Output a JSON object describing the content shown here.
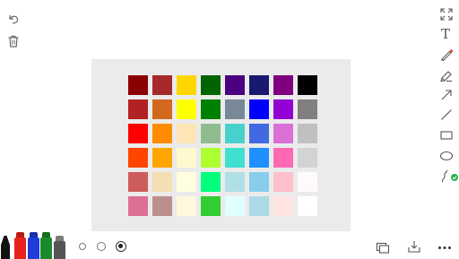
{
  "left_tools": {
    "undo_icon": "undo-icon",
    "delete_icon": "trash-icon"
  },
  "right_toolbar": {
    "items": [
      {
        "name": "fullscreen-icon"
      },
      {
        "name": "text-tool-icon",
        "glyph": "T"
      },
      {
        "name": "pen-tool-icon",
        "accent": "#e0403a"
      },
      {
        "name": "highlighter-tool-icon"
      },
      {
        "name": "arrow-tool-icon"
      },
      {
        "name": "line-tool-icon"
      },
      {
        "name": "rectangle-tool-icon"
      },
      {
        "name": "ellipse-tool-icon"
      },
      {
        "name": "freehand-tool-icon",
        "badge_color": "#2bb24c"
      }
    ]
  },
  "palette": {
    "rows": [
      [
        "#8b0000",
        "#a52a2a",
        "#ffd700",
        "#006400",
        "#4b0082",
        "#191970",
        "#800080",
        "#000000"
      ],
      [
        "#b22222",
        "#d2691e",
        "#ffff00",
        "#008000",
        "#778899",
        "#0000ff",
        "#9400d3",
        "#808080"
      ],
      [
        "#ff0000",
        "#ff8c00",
        "#ffe4b5",
        "#8fbc8f",
        "#48d1cc",
        "#4169e1",
        "#da70d6",
        "#c0c0c0"
      ],
      [
        "#ff4500",
        "#ffa500",
        "#fffacd",
        "#adff2f",
        "#40e0d0",
        "#1e90ff",
        "#ff69b4",
        "#d3d3d3"
      ],
      [
        "#cd5c5c",
        "#f5deb3",
        "#ffffe0",
        "#00ff7f",
        "#b0e0e6",
        "#87ceeb",
        "#ffc0cb",
        "#fffafa"
      ],
      [
        "#db7093",
        "#bc8f8f",
        "#fff8dc",
        "#32cd32",
        "#e0ffff",
        "#add8e6",
        "#ffe4e1",
        "#ffffff"
      ]
    ]
  },
  "pens": [
    {
      "color": "#111111"
    },
    {
      "color": "#e8221c"
    },
    {
      "color": "#1f3bd9"
    },
    {
      "color": "#1a8a2a"
    },
    {
      "color": "#555555"
    }
  ],
  "stroke_sizes": [
    "small",
    "medium",
    "large"
  ],
  "selected_stroke": "large",
  "bottom_right": {
    "items": [
      "layers-icon",
      "download-icon",
      "more-icon"
    ]
  }
}
